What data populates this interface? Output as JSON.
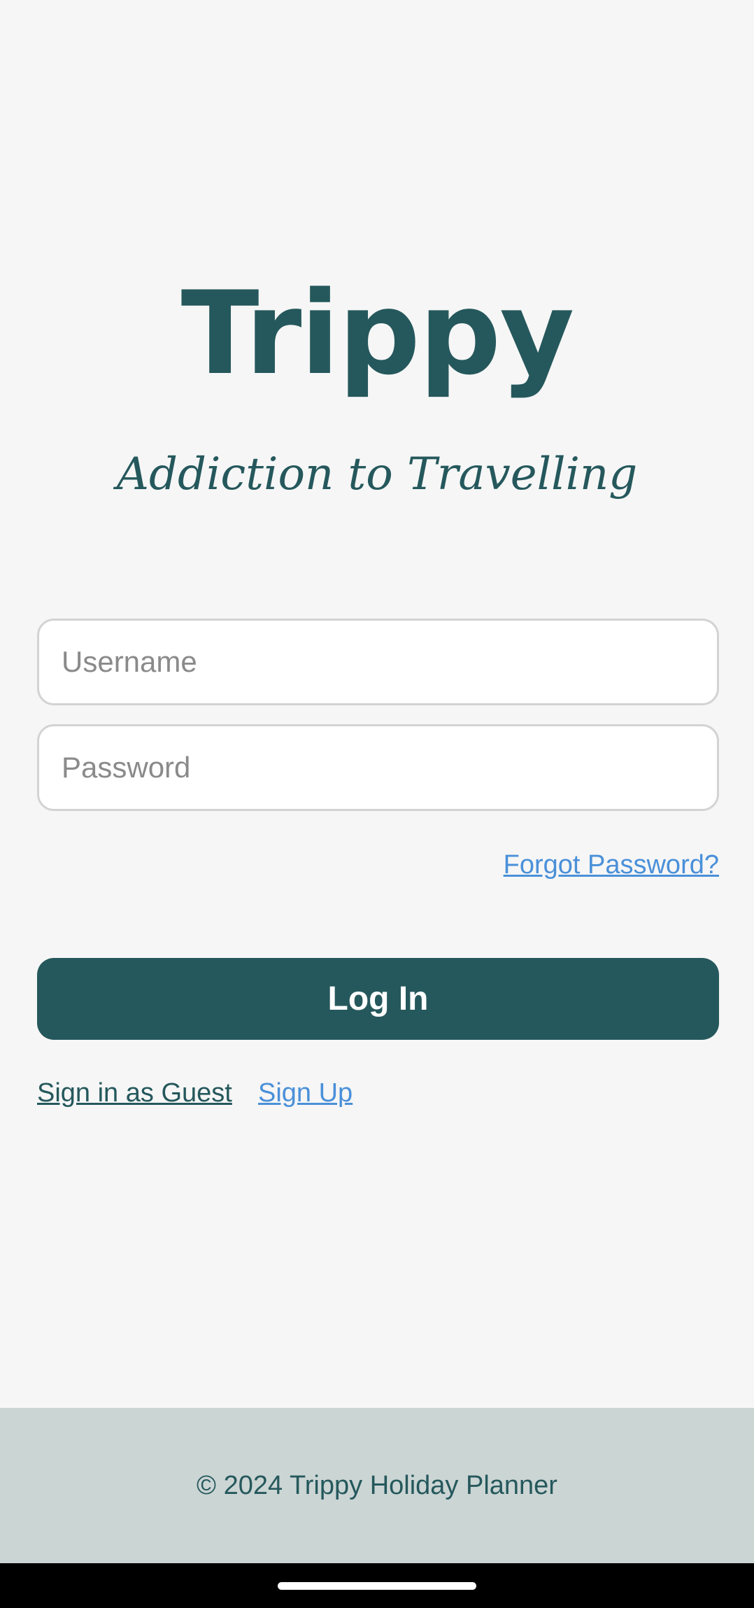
{
  "app": {
    "title": "Trippy",
    "tagline": "Addiction to Travelling"
  },
  "form": {
    "username": {
      "placeholder": "Username",
      "value": ""
    },
    "password": {
      "placeholder": "Password",
      "value": ""
    },
    "forgot_password_label": "Forgot Password?",
    "login_label": "Log In",
    "guest_label": "Sign in as Guest",
    "signup_label": "Sign Up"
  },
  "footer": {
    "text": "© 2024 Trippy Holiday Planner"
  },
  "colors": {
    "primary": "#25585c",
    "link": "#4a90d9",
    "background": "#f6f6f6",
    "footer_background": "#cbd5d4"
  }
}
